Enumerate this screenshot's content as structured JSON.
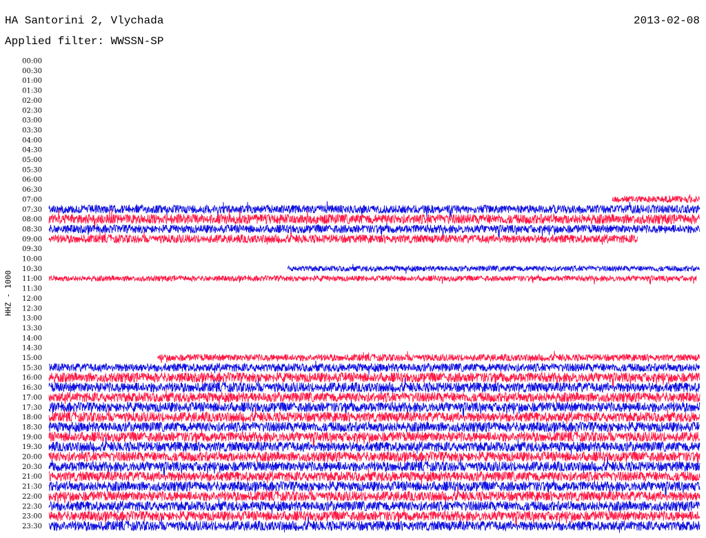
{
  "header": {
    "station": "HA Santorini 2, Vlychada",
    "date": "2013-02-08",
    "filter_label": "Applied filter: WWSSN-SP"
  },
  "channel_label": "HHZ - 1000",
  "colors": {
    "odd_trace": "#ff1744",
    "even_trace": "#1010e0",
    "background": "#ffffff",
    "text": "#000000"
  },
  "chart_data": {
    "type": "line",
    "title": "HA Santorini 2, Vlychada",
    "subtitle": "Applied filter: WWSSN-SP",
    "ylabel": "HHZ - 1000",
    "tick_labels": [
      "00:00",
      "00:30",
      "01:00",
      "01:30",
      "02:00",
      "02:30",
      "03:00",
      "03:30",
      "04:00",
      "04:30",
      "05:00",
      "05:30",
      "06:00",
      "06:30",
      "07:00",
      "07:30",
      "08:00",
      "08:30",
      "09:00",
      "09:30",
      "10:00",
      "10:30",
      "11:00",
      "11:30",
      "12:00",
      "12:30",
      "13:00",
      "13:30",
      "14:00",
      "14:30",
      "15:00",
      "15:30",
      "16:00",
      "16:30",
      "17:00",
      "17:30",
      "18:00",
      "18:30",
      "19:00",
      "19:30",
      "20:00",
      "20:30",
      "21:00",
      "21:30",
      "22:00",
      "22:30",
      "23:00",
      "23:30"
    ],
    "traces": [
      {
        "row": "07:00",
        "start": 0.865,
        "end": 1.0,
        "amplitude": 5
      },
      {
        "row": "07:30",
        "start": 0.0,
        "end": 1.0,
        "amplitude": 6
      },
      {
        "row": "08:00",
        "start": 0.0,
        "end": 1.0,
        "amplitude": 7
      },
      {
        "row": "08:30",
        "start": 0.0,
        "end": 1.0,
        "amplitude": 6
      },
      {
        "row": "09:00",
        "start": 0.0,
        "end": 0.905,
        "amplitude": 6
      },
      {
        "row": "10:30",
        "start": 0.367,
        "end": 1.0,
        "amplitude": 4
      },
      {
        "row": "11:00",
        "start": 0.0,
        "end": 0.995,
        "amplitude": 4
      },
      {
        "row": "15:00",
        "start": 0.167,
        "end": 1.0,
        "amplitude": 5
      },
      {
        "row": "15:30",
        "start": 0.0,
        "end": 1.0,
        "amplitude": 6
      },
      {
        "row": "16:00",
        "start": 0.0,
        "end": 1.0,
        "amplitude": 7
      },
      {
        "row": "16:30",
        "start": 0.0,
        "end": 1.0,
        "amplitude": 7
      },
      {
        "row": "17:00",
        "start": 0.0,
        "end": 1.0,
        "amplitude": 7
      },
      {
        "row": "17:30",
        "start": 0.0,
        "end": 1.0,
        "amplitude": 7
      },
      {
        "row": "18:00",
        "start": 0.0,
        "end": 1.0,
        "amplitude": 7
      },
      {
        "row": "18:30",
        "start": 0.0,
        "end": 1.0,
        "amplitude": 7
      },
      {
        "row": "19:00",
        "start": 0.0,
        "end": 1.0,
        "amplitude": 7
      },
      {
        "row": "19:30",
        "start": 0.0,
        "end": 1.0,
        "amplitude": 7
      },
      {
        "row": "20:00",
        "start": 0.0,
        "end": 1.0,
        "amplitude": 7
      },
      {
        "row": "20:30",
        "start": 0.0,
        "end": 1.0,
        "amplitude": 7
      },
      {
        "row": "21:00",
        "start": 0.0,
        "end": 1.0,
        "amplitude": 7
      },
      {
        "row": "21:30",
        "start": 0.0,
        "end": 1.0,
        "amplitude": 7
      },
      {
        "row": "22:00",
        "start": 0.0,
        "end": 1.0,
        "amplitude": 7
      },
      {
        "row": "22:30",
        "start": 0.0,
        "end": 1.0,
        "amplitude": 7
      },
      {
        "row": "23:00",
        "start": 0.0,
        "end": 1.0,
        "amplitude": 7
      },
      {
        "row": "23:30",
        "start": 0.0,
        "end": 1.0,
        "amplitude": 7
      }
    ]
  }
}
